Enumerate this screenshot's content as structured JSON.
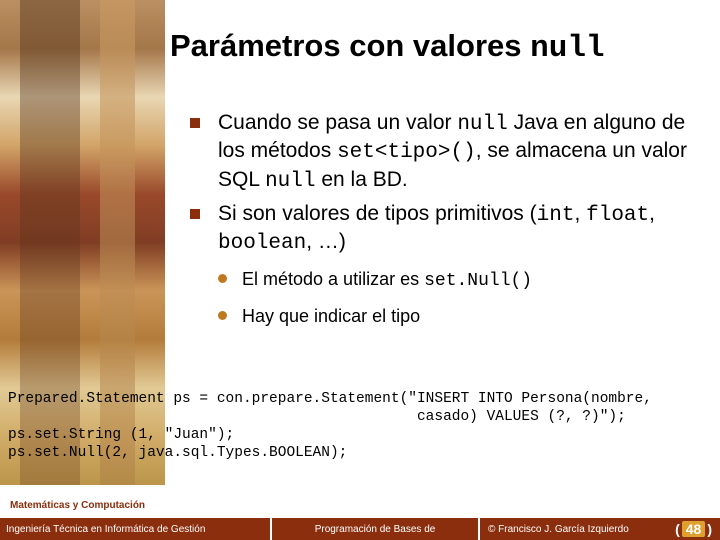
{
  "title": {
    "prefix": "Parámetros con valores ",
    "code": "null"
  },
  "bullets": [
    {
      "parts": [
        {
          "t": "Cuando se pasa un valor "
        },
        {
          "t": "null",
          "code": true
        },
        {
          "t": " Java en alguno de los métodos "
        },
        {
          "t": "set<tipo>()",
          "code": true
        },
        {
          "t": ", se almacena un valor SQL "
        },
        {
          "t": "null",
          "code": true
        },
        {
          "t": " en la BD."
        }
      ]
    },
    {
      "parts": [
        {
          "t": "Si son valores de tipos primitivos ("
        },
        {
          "t": "int",
          "code": true
        },
        {
          "t": ", "
        },
        {
          "t": "float",
          "code": true
        },
        {
          "t": ", "
        },
        {
          "t": "boolean",
          "code": true
        },
        {
          "t": ", …)"
        }
      ]
    }
  ],
  "subbullets": [
    {
      "parts": [
        {
          "t": "El método a utilizar es "
        },
        {
          "t": "set.Null()",
          "code": true
        }
      ]
    },
    {
      "parts": [
        {
          "t": "Hay que indicar el tipo"
        }
      ]
    }
  ],
  "code_lines": [
    "Prepared.Statement ps = con.prepare.Statement(\"INSERT INTO Persona(nombre,",
    "                                               casado) VALUES (?, ?)\");",
    "ps.set.String (1, \"Juan\");",
    "ps.set.Null(2, java.sql.Types.BOOLEAN);"
  ],
  "dept": "Matemáticas y Computación",
  "footer": {
    "left": "Ingeniería Técnica en Informática de Gestión",
    "mid": "Programación de Bases de",
    "copyright": "© Francisco J. García Izquierdo",
    "page": "48"
  }
}
